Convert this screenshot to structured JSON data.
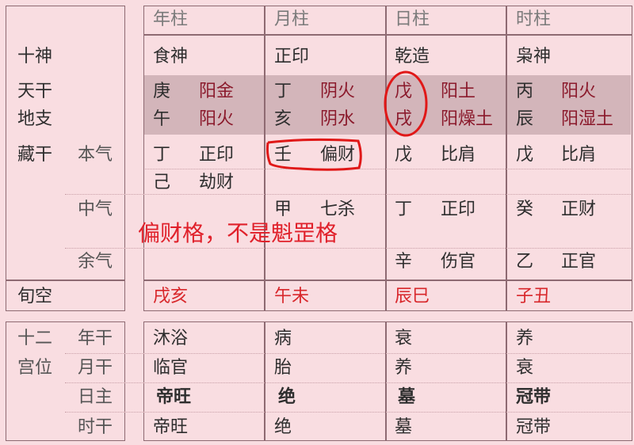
{
  "header": {
    "columns": [
      "年柱",
      "月柱",
      "日柱",
      "时柱"
    ]
  },
  "row_labels": {
    "shishen": "十神",
    "tiangan": "天干",
    "dizhi": "地支",
    "canggan": "藏干",
    "benqi": "本气",
    "zhongqi": "中气",
    "yuqi": "余气",
    "xunkong": "旬空",
    "shier": "十二",
    "gongwei": "宫位",
    "nian_gan": "年干",
    "yue_gan": "月干",
    "ri_zhu": "日主",
    "shi_gan": "时干"
  },
  "pillars": [
    {
      "shishen": "食神",
      "stem": "庚",
      "stem_element": "阳金",
      "branch": "午",
      "branch_element": "阳火",
      "benqi": [
        "丁",
        "正印"
      ],
      "benqi2": [
        "己",
        "劫财"
      ],
      "zhongqi": [
        "",
        ""
      ],
      "yuqi": [
        "",
        ""
      ],
      "xunkong": "戌亥",
      "stages": [
        "沐浴",
        "临官",
        "帝旺",
        "帝旺"
      ]
    },
    {
      "shishen": "正印",
      "stem": "丁",
      "stem_element": "阴火",
      "branch": "亥",
      "branch_element": "阴水",
      "benqi": [
        "壬",
        "偏财"
      ],
      "benqi2": [
        "",
        ""
      ],
      "zhongqi": [
        "甲",
        "七杀"
      ],
      "yuqi": [
        "",
        ""
      ],
      "xunkong": "午未",
      "stages": [
        "病",
        "胎",
        "绝",
        "绝"
      ]
    },
    {
      "shishen": "乾造",
      "stem": "戊",
      "stem_element": "阳土",
      "branch": "戌",
      "branch_element": "阳燥土",
      "benqi": [
        "戊",
        "比肩"
      ],
      "benqi2": [
        "",
        ""
      ],
      "zhongqi": [
        "丁",
        "正印"
      ],
      "yuqi": [
        "辛",
        "伤官"
      ],
      "xunkong": "辰巳",
      "stages": [
        "衰",
        "养",
        "墓",
        "墓"
      ]
    },
    {
      "shishen": "枭神",
      "stem": "丙",
      "stem_element": "阳火",
      "branch": "辰",
      "branch_element": "阳湿土",
      "benqi": [
        "戊",
        "比肩"
      ],
      "benqi2": [
        "",
        ""
      ],
      "zhongqi": [
        "癸",
        "正财"
      ],
      "yuqi": [
        "乙",
        "正官"
      ],
      "xunkong": "子丑",
      "stages": [
        "养",
        "衰",
        "冠带",
        "冠带"
      ]
    }
  ],
  "annotation": {
    "text": "偏财格，不是魁罡格",
    "color": "#e0202a"
  },
  "colors": {
    "background": "#f9dde1",
    "band": "#d3b5ba",
    "element_text": "#8b1a2c",
    "xunkong_text": "#d8262a",
    "border": "#8e6a72"
  }
}
